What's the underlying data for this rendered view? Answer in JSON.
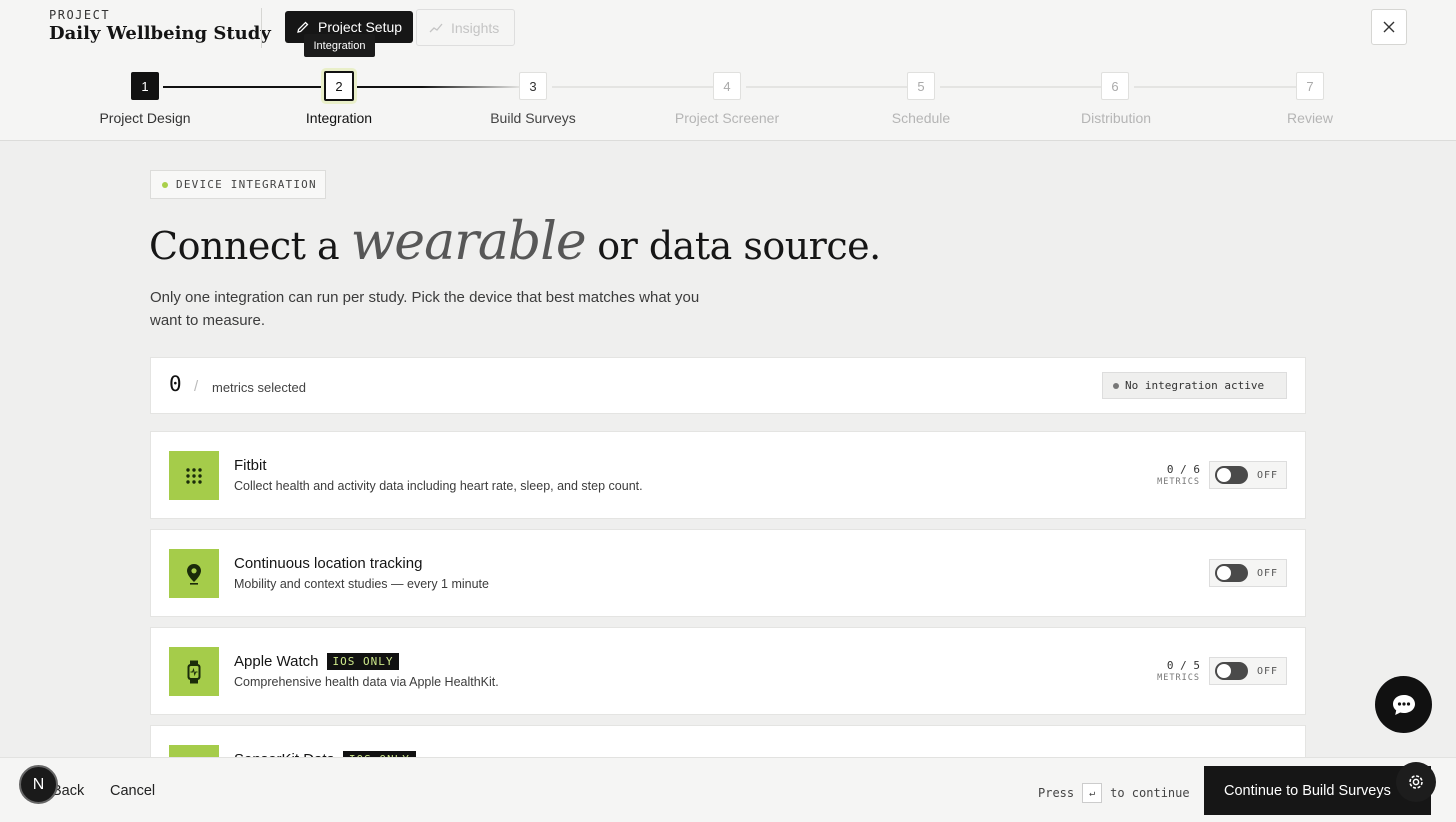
{
  "header": {
    "project_label": "PROJECT",
    "project_title": "Daily Wellbeing Study",
    "tab_setup": "Project Setup",
    "tab_insights": "Insights",
    "tooltip": "Integration"
  },
  "steps": [
    {
      "number": "1",
      "label": "Project Design",
      "state": "done"
    },
    {
      "number": "2",
      "label": "Integration",
      "state": "current"
    },
    {
      "number": "3",
      "label": "Build Surveys",
      "state": "next"
    },
    {
      "number": "4",
      "label": "Project Screener",
      "state": "upcoming"
    },
    {
      "number": "5",
      "label": "Schedule",
      "state": "upcoming"
    },
    {
      "number": "6",
      "label": "Distribution",
      "state": "upcoming"
    },
    {
      "number": "7",
      "label": "Review",
      "state": "upcoming"
    }
  ],
  "main": {
    "chip": "DEVICE INTEGRATION",
    "headline_a": "Connect a",
    "headline_italic": "wearable",
    "headline_b": "or data source.",
    "subtext": "Only one integration can run per study. Pick the device that best matches what you want to measure."
  },
  "metrics": {
    "count": "0",
    "slash": "/",
    "label": "metrics selected",
    "status": "No integration active"
  },
  "integrations": [
    {
      "title": "Fitbit",
      "badge": "",
      "desc": "Collect health and activity data including heart rate, sleep, and step count.",
      "metrics": "0 / 6",
      "metrics_label": "METRICS",
      "toggle": "OFF"
    },
    {
      "title": "Continuous location tracking",
      "badge": "",
      "desc": "Mobility and context studies — every 1 minute",
      "metrics": "",
      "metrics_label": "",
      "toggle": "OFF"
    },
    {
      "title": "Apple Watch",
      "badge": "IOS ONLY",
      "desc": "Comprehensive health data via Apple HealthKit.",
      "metrics": "0 / 5",
      "metrics_label": "METRICS",
      "toggle": "OFF"
    },
    {
      "title": "SensorKit Data",
      "badge": "IOS ONLY",
      "desc": "",
      "metrics": "",
      "metrics_label": "",
      "toggle": ""
    }
  ],
  "footer": {
    "back": "Back",
    "cancel": "Cancel",
    "press": "Press",
    "key": "↵",
    "to_continue": "to continue",
    "continue_button": "Continue to Build Surveys"
  },
  "avatar": "N",
  "colors": {
    "accent_green": "#a5cc4a",
    "dark": "#161616"
  }
}
